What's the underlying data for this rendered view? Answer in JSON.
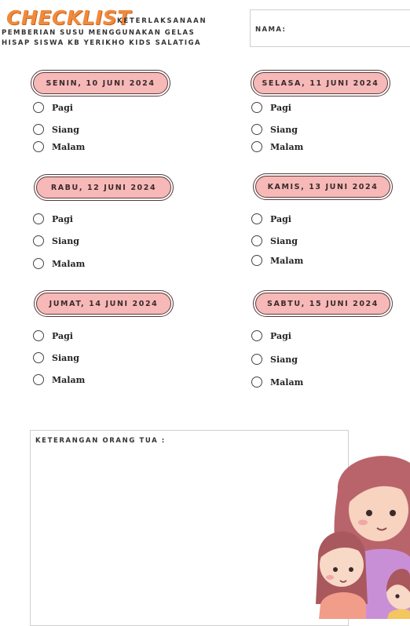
{
  "header": {
    "title_highlight": "CHECKLIST",
    "title_rest": "KETERLAKSANAAN",
    "subtitle_line1": "PEMBERIAN SUSU MENGGUNAKAN GELAS",
    "subtitle_line2": "HISAP SISWA KB YERIKHO KIDS SALATIGA"
  },
  "name_field": {
    "label": "NAMA:"
  },
  "days": [
    {
      "label": "SENIN, 10 JUNI 2024",
      "options": [
        "Pagi",
        "Siang",
        "Malam"
      ]
    },
    {
      "label": "SELASA, 11 JUNI 2024",
      "options": [
        "Pagi",
        "Siang",
        "Malam"
      ]
    },
    {
      "label": "RABU, 12 JUNI 2024",
      "options": [
        "Pagi",
        "Siang",
        "Malam"
      ]
    },
    {
      "label": "KAMIS, 13 JUNI 2024",
      "options": [
        "Pagi",
        "Siang",
        "Malam"
      ]
    },
    {
      "label": "JUMAT, 14 JUNI 2024",
      "options": [
        "Pagi",
        "Siang",
        "Malam"
      ]
    },
    {
      "label": "SABTU, 15 JUNI 2024",
      "options": [
        "Pagi",
        "Siang",
        "Malam"
      ]
    }
  ],
  "notes": {
    "label": "KETERANGAN ORANG TUA :"
  },
  "colors": {
    "accent_orange": "#f08a3c",
    "pill_pink": "#f6b9b8",
    "pill_border": "#5a3a3a"
  },
  "illustration": {
    "icon": "mother-and-children-illustration"
  }
}
